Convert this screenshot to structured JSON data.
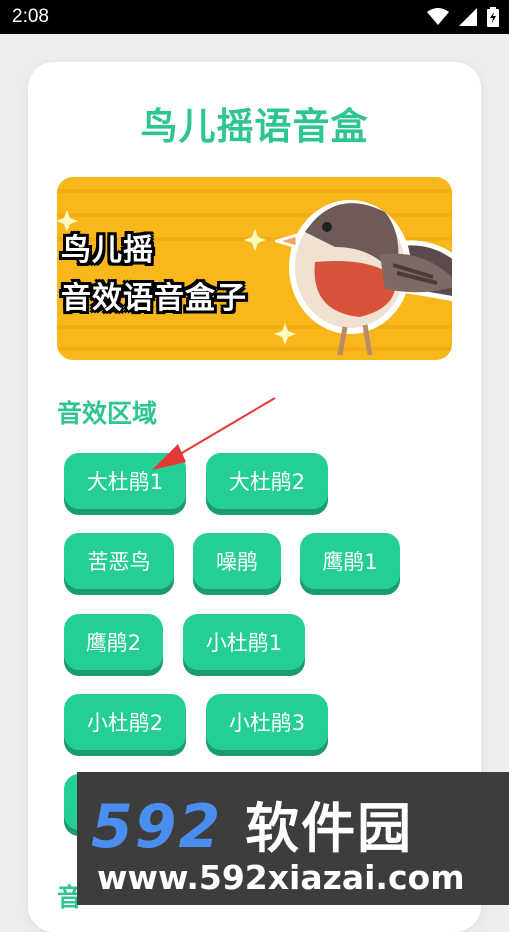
{
  "status_bar": {
    "time": "2:08",
    "icons": [
      "wifi-icon",
      "signal-icon",
      "battery-icon"
    ]
  },
  "app": {
    "title": "鸟儿摇语音盒"
  },
  "banner": {
    "line1": "鸟儿摇",
    "line2": "音效语音盒子",
    "background": "#f8b81c"
  },
  "sections": [
    {
      "title": "音效区域",
      "buttons": [
        "大杜鹃1",
        "大杜鹃2",
        "苦恶鸟",
        "噪鹃",
        "鹰鹃1",
        "鹰鹃2",
        "小杜鹃1",
        "小杜鹃2",
        "小杜鹃3"
      ]
    },
    {
      "title": "音"
    }
  ],
  "watermark": {
    "brand_digits": "592",
    "brand_text": "软件园",
    "url": "www.592xiazai.com"
  },
  "colors": {
    "accent": "#2fc493",
    "button": "#25cf93",
    "button_shadow": "#1a9b6f",
    "annotation_arrow": "#e53935"
  }
}
